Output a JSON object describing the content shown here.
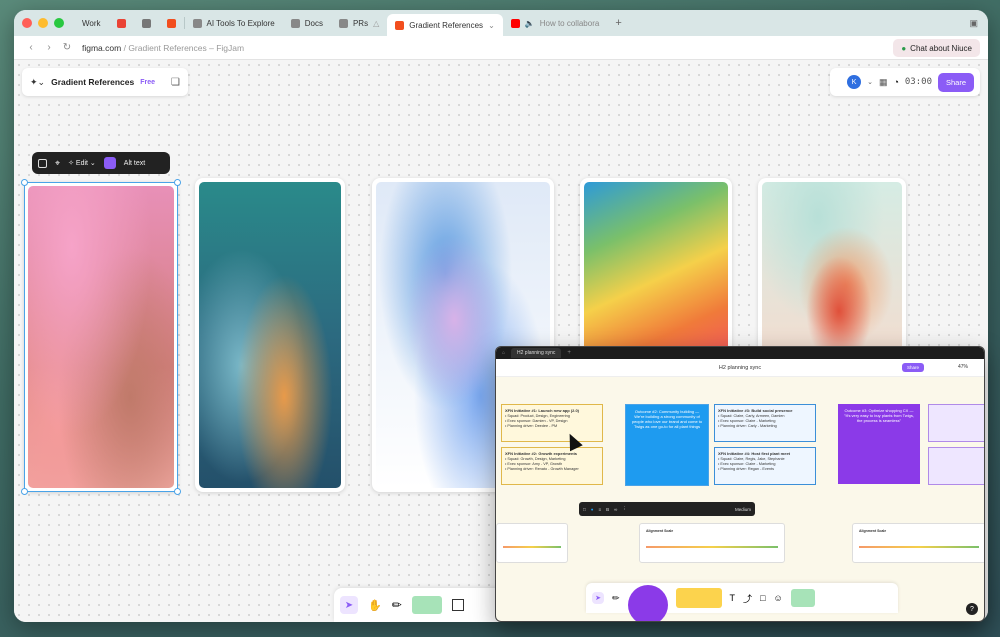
{
  "browser": {
    "tabs": [
      {
        "label": "Work",
        "color": "#6b7b7b"
      },
      {
        "label": "",
        "icon": "gmail-icon",
        "color": "#ea4335"
      },
      {
        "label": "",
        "icon": "calendar-icon",
        "color": "#555555"
      },
      {
        "label": "",
        "icon": "figma-icon",
        "color": "#f24e1e"
      },
      {
        "label": "AI Tools To Explore",
        "color": "#555555"
      },
      {
        "label": "Docs",
        "color": "#555555"
      },
      {
        "label": "PRs",
        "color": "#555555"
      },
      {
        "label": "Gradient References",
        "color": "#f24e1e",
        "active": true
      },
      {
        "label": "How to collabora",
        "color": "#ff0000"
      }
    ],
    "url_domain": "figma.com",
    "url_path": "/ Gradient References – FigJam",
    "chat_button": "Chat about Niuce"
  },
  "file": {
    "name": "Gradient References",
    "plan": "Free"
  },
  "topbar": {
    "avatar_initial": "K",
    "timer": "03:00",
    "share_label": "Share"
  },
  "image_toolbar": {
    "edit_label": "Edit",
    "alt_text_label": "Alt text"
  },
  "overlay": {
    "tab_label": "H2 planning sync",
    "title": "H2 planning sync",
    "share_label": "Share",
    "zoom": "47%",
    "stickies": [
      {
        "title": "XFN Initiative #1: Launch new app (2.0)",
        "lines": [
          "Squad: Product, Design, Engineering",
          "Exec sponsor: Damien - VP, Design",
          "Planning driver: Deedee - PM"
        ]
      },
      {
        "title": "XFN Initiative #2: Growth experiments",
        "lines": [
          "Squad: Growth, Design, Marketing",
          "Exec sponsor: Amy - VP, Growth",
          "Planning driver: Renato - Growth Manager"
        ]
      },
      {
        "title": "XFN Initiative #3: Build social presence",
        "lines": [
          "Squad: Claire, Carly, Armeen, Damien",
          "Exec sponsor: Claire - Marketing",
          "Planning driver: Carly - Marketing"
        ]
      },
      {
        "title": "XFN Initiative #4: Host first plant meet",
        "lines": [
          "Squad: Claire, Regis, Jake, Stephanie",
          "Exec sponsor: Claire - Marketing",
          "Planning driver: Regan - Events"
        ]
      }
    ],
    "blue_card": "Outcome #2: Community building — We're building a strong community of people who love our brand and come to Twigs as one go-to for all plant things",
    "purple_card": "Outcome #3: Optimize shopping CX — \"It's very easy to buy plants from Twigs, the process is seamless\"",
    "timeline_label": "Alignment Scale",
    "toolbar_size": "Medium"
  }
}
